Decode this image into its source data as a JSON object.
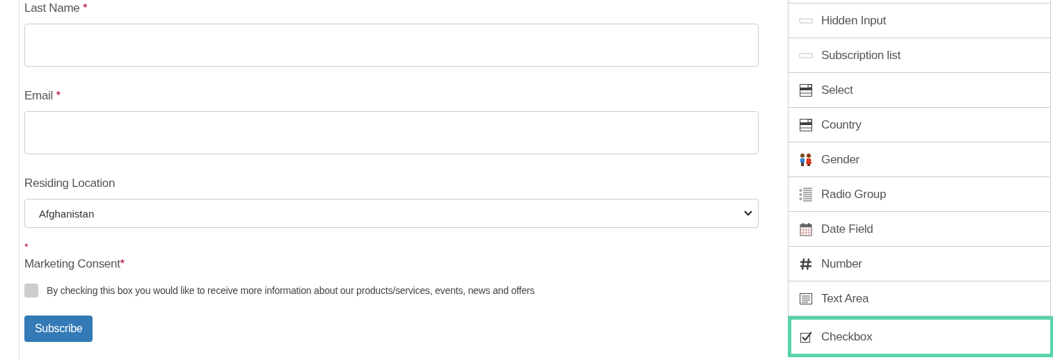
{
  "form": {
    "fields": [
      {
        "kind": "text",
        "label": "Last Name",
        "required_mark": "*"
      },
      {
        "kind": "text",
        "label": "Email",
        "required_mark": "*"
      },
      {
        "kind": "select",
        "label": "Residing Location",
        "value": "Afghanistan"
      }
    ],
    "consent": {
      "top_mark": "*",
      "label": "Marketing Consent",
      "required_mark": "*",
      "text": "By checking this box you would like to receive more information about our products/services, events, news and offers",
      "checked": false
    },
    "button": "Subscribe"
  },
  "palette": {
    "items": [
      {
        "kind": "hidden",
        "label": "Hidden Input",
        "selected": false
      },
      {
        "kind": "hidden",
        "label": "Subscription list",
        "selected": false
      },
      {
        "kind": "select",
        "label": "Select",
        "selected": false
      },
      {
        "kind": "select",
        "label": "Country",
        "selected": false
      },
      {
        "kind": "gender",
        "label": "Gender",
        "selected": false
      },
      {
        "kind": "radio",
        "label": "Radio Group",
        "selected": false
      },
      {
        "kind": "date",
        "label": "Date Field",
        "selected": false
      },
      {
        "kind": "number",
        "label": "Number",
        "selected": false
      },
      {
        "kind": "textarea",
        "label": "Text Area",
        "selected": false
      },
      {
        "kind": "checkbox",
        "label": "Checkbox",
        "selected": true
      }
    ]
  }
}
